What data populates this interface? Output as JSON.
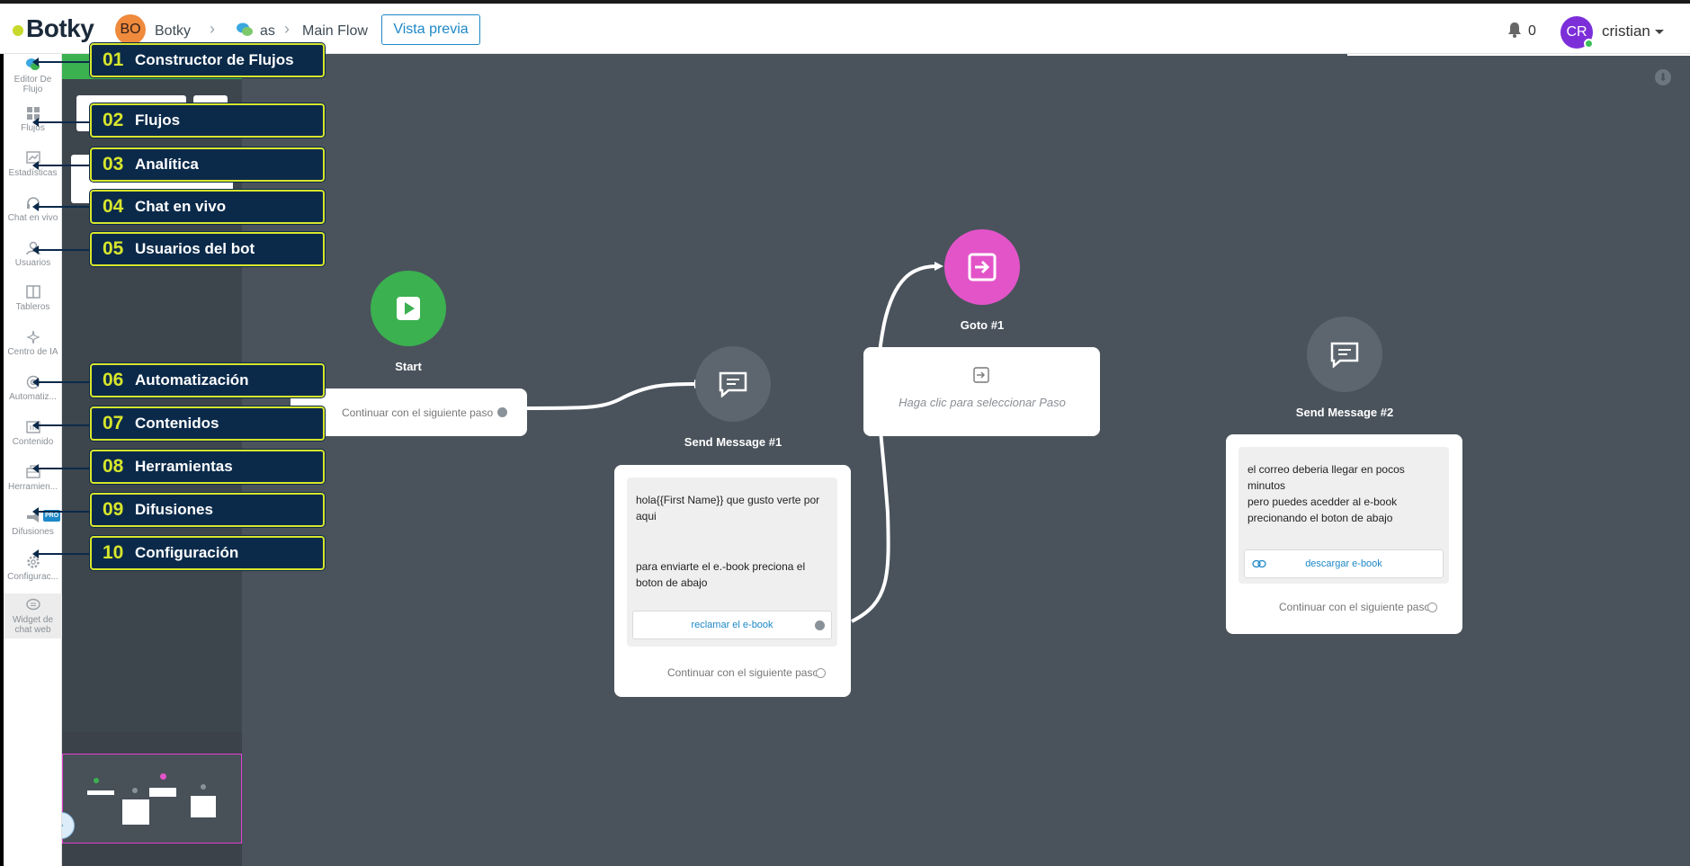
{
  "brand": {
    "name": "Botky",
    "accent": "#1d88c7"
  },
  "header": {
    "bot_initials": "BO",
    "bot_name": "Botky",
    "flow_name": "as",
    "flow_page": "Main Flow",
    "preview_label": "Vista previa",
    "notification_count": "0",
    "user_initials": "CR",
    "user_name": "cristian"
  },
  "sidebar": {
    "items": [
      {
        "label": "Editor De Flujo",
        "icon": "flow-editor-icon"
      },
      {
        "label": "Flujos",
        "icon": "grid-icon"
      },
      {
        "label": "Estadísticas",
        "icon": "chart-icon"
      },
      {
        "label": "Chat en vivo",
        "icon": "headset-icon"
      },
      {
        "label": "Usuarios",
        "icon": "user-icon"
      },
      {
        "label": "Tableros",
        "icon": "board-icon"
      },
      {
        "label": "Centro de IA",
        "icon": "sparkle-icon"
      },
      {
        "label": "Automatiz...",
        "icon": "at-icon"
      },
      {
        "label": "Contenido",
        "icon": "content-icon"
      },
      {
        "label": "Herramien...",
        "icon": "toolbox-icon"
      },
      {
        "label": "Difusiones",
        "icon": "megaphone-icon"
      },
      {
        "label": "Configurac...",
        "icon": "gear-icon"
      },
      {
        "label": "Widget de chat web",
        "icon": "chat-widget-icon"
      }
    ],
    "pro_badge": "PRO"
  },
  "callouts": [
    {
      "num": "01",
      "label": "Constructor de Flujos"
    },
    {
      "num": "02",
      "label": "Flujos"
    },
    {
      "num": "03",
      "label": "Analítica"
    },
    {
      "num": "04",
      "label": "Chat en vivo"
    },
    {
      "num": "05",
      "label": "Usuarios del bot"
    },
    {
      "num": "06",
      "label": "Automatización"
    },
    {
      "num": "07",
      "label": "Contenidos"
    },
    {
      "num": "08",
      "label": "Herramientas"
    },
    {
      "num": "09",
      "label": "Difusiones"
    },
    {
      "num": "10",
      "label": "Configuración"
    }
  ],
  "flow": {
    "start": {
      "title": "Start",
      "continue": "Continuar con el siguiente paso",
      "color": "#3bb150"
    },
    "send1": {
      "title": "Send Message #1",
      "text1": "hola{{First Name}} que gusto verte por aqui",
      "text2": "para enviarte el e.-book preciona el boton de abajo",
      "button": "reclamar el e-book",
      "continue": "Continuar con el siguiente paso"
    },
    "goto": {
      "title": "Goto #1",
      "hint": "Haga clic para seleccionar Paso",
      "color": "#e354c9"
    },
    "send2": {
      "title": "Send Message #2",
      "text": "el correo deberia llegar en pocos minutos\npero puedes acedder al e-book precionando el boton de abajo",
      "button": "descargar e-book",
      "continue": "Continuar con el siguiente paso"
    }
  }
}
